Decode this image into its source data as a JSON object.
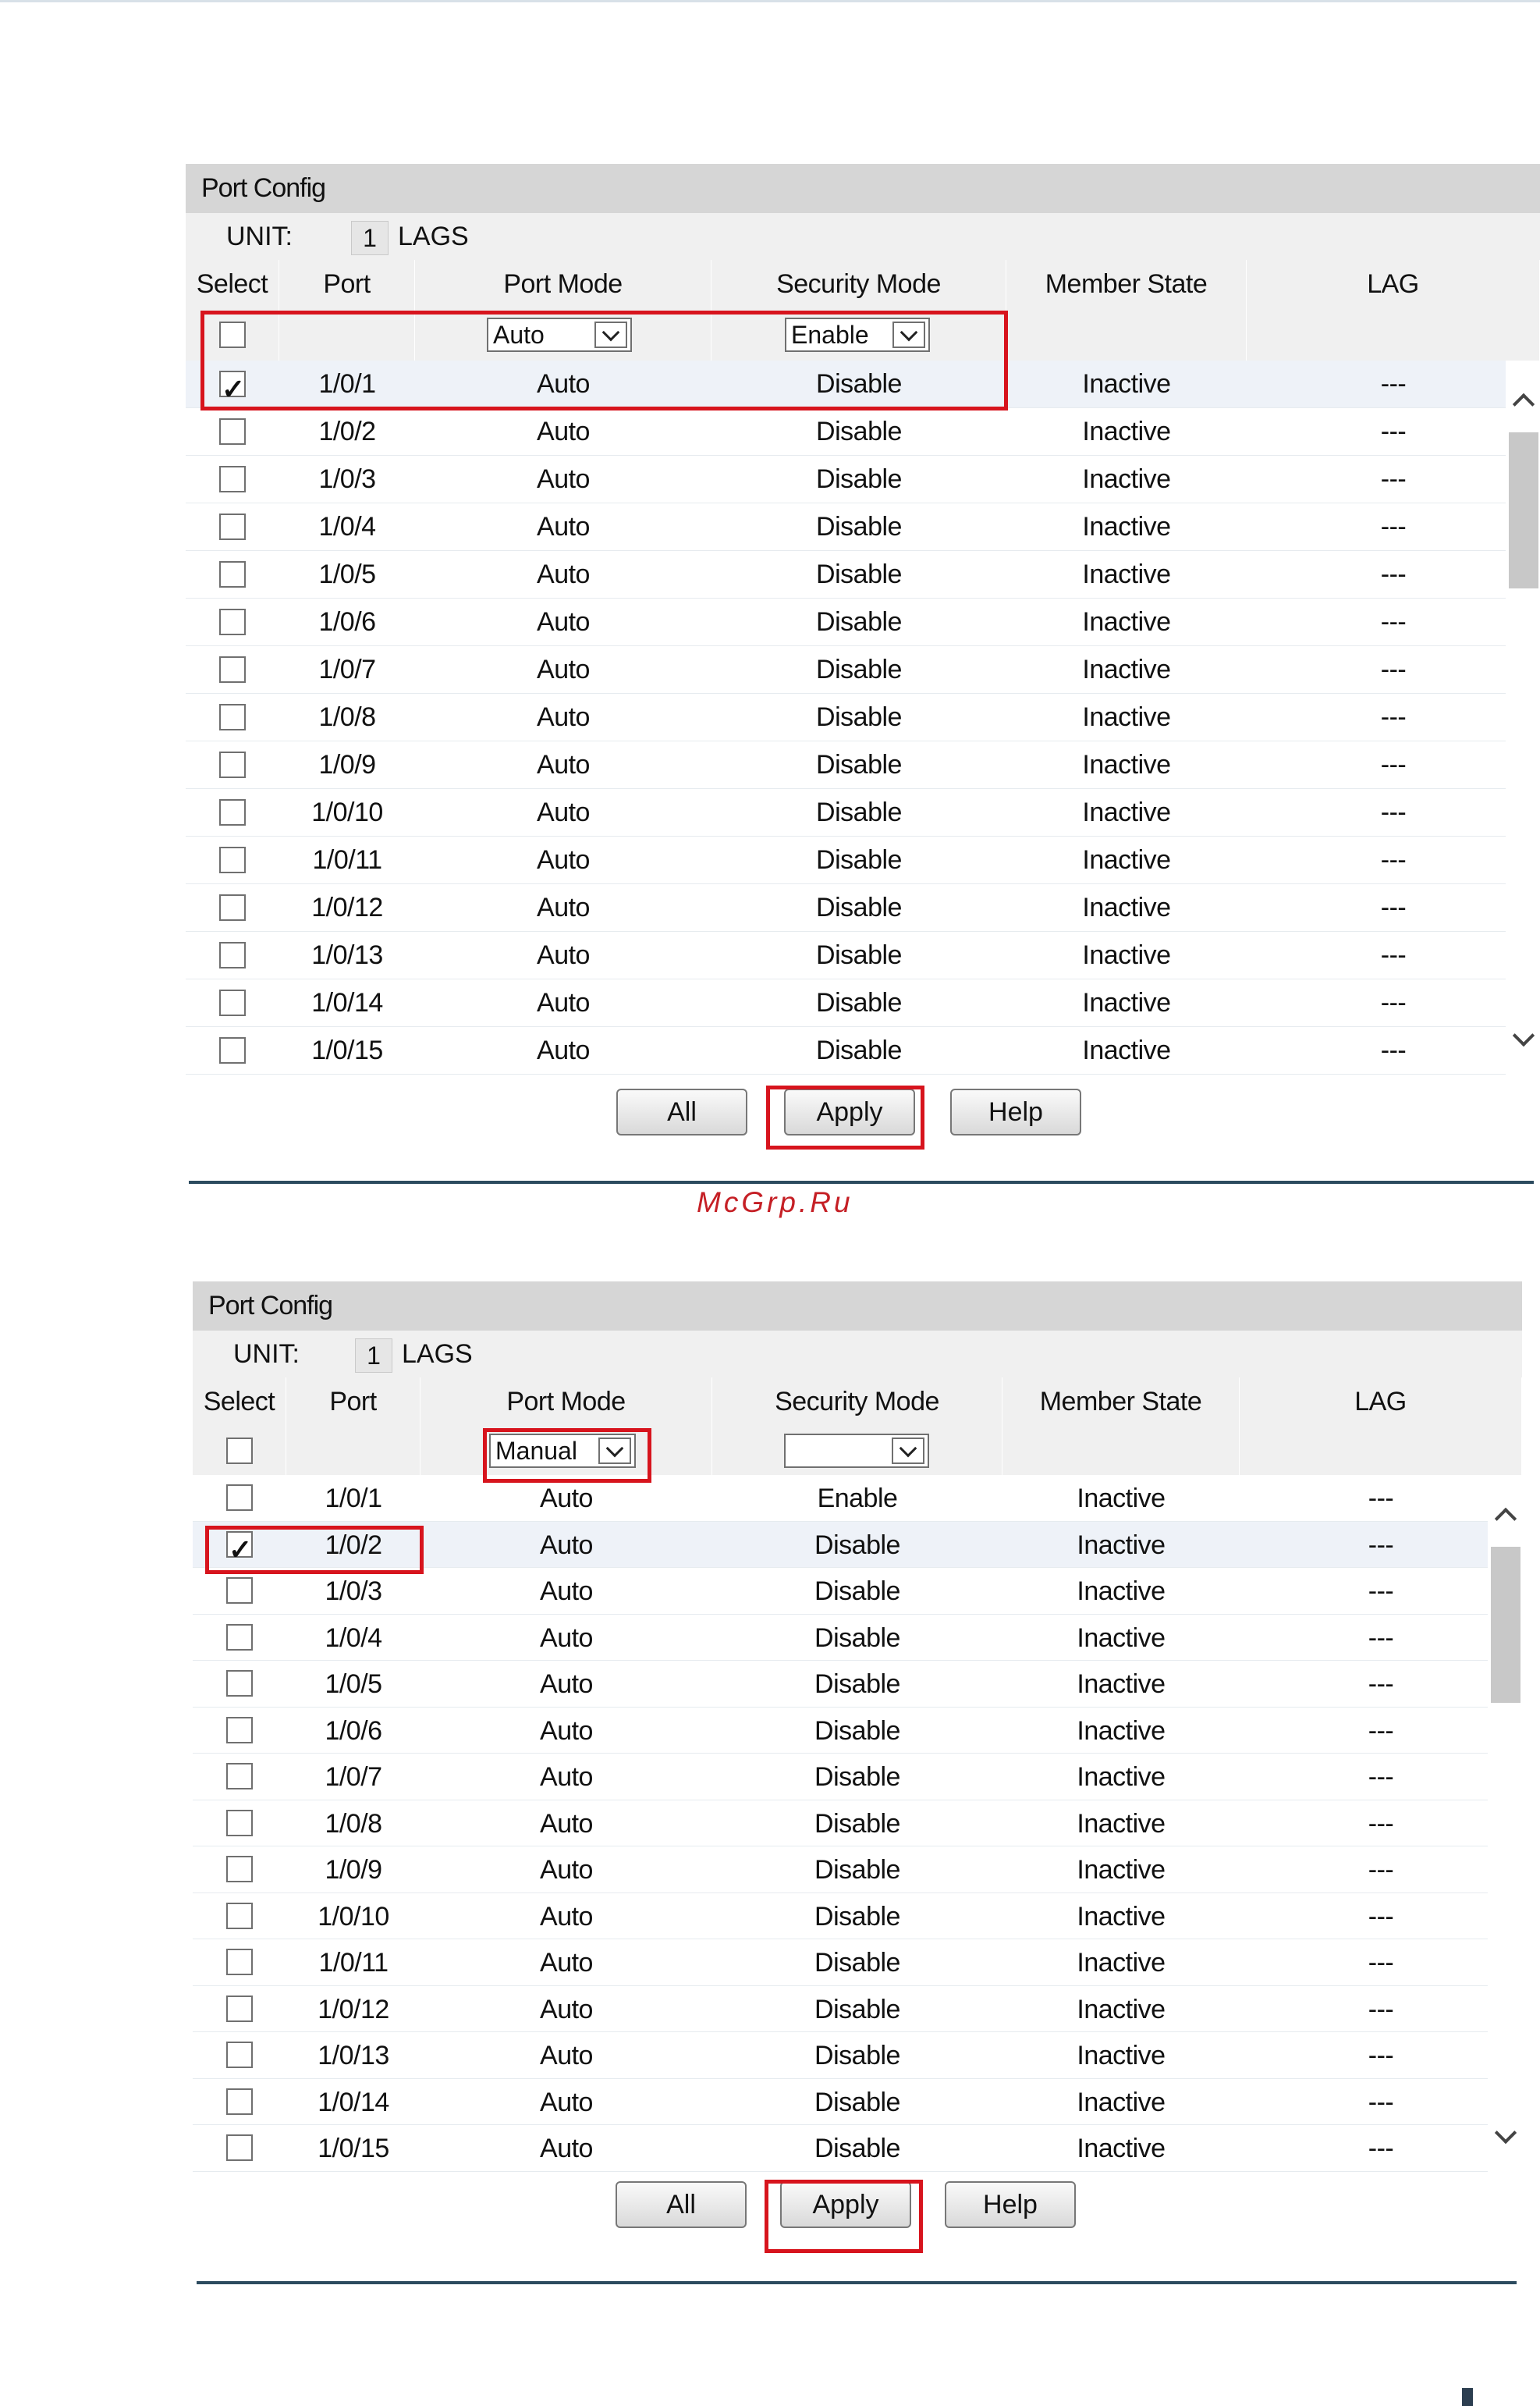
{
  "panels": [
    {
      "title": "Port Config",
      "unit_label": "UNIT:",
      "unit_value": "1",
      "lags_label": "LAGS",
      "columns": [
        "Select",
        "Port",
        "Port Mode",
        "Security Mode",
        "Member State",
        "LAG"
      ],
      "filter": {
        "select_all_checked": false,
        "port_mode": "Auto",
        "security_mode": "Enable"
      },
      "rows": [
        {
          "checked": true,
          "port": "1/0/1",
          "port_mode": "Auto",
          "security_mode": "Disable",
          "member_state": "Inactive",
          "lag": "---"
        },
        {
          "checked": false,
          "port": "1/0/2",
          "port_mode": "Auto",
          "security_mode": "Disable",
          "member_state": "Inactive",
          "lag": "---"
        },
        {
          "checked": false,
          "port": "1/0/3",
          "port_mode": "Auto",
          "security_mode": "Disable",
          "member_state": "Inactive",
          "lag": "---"
        },
        {
          "checked": false,
          "port": "1/0/4",
          "port_mode": "Auto",
          "security_mode": "Disable",
          "member_state": "Inactive",
          "lag": "---"
        },
        {
          "checked": false,
          "port": "1/0/5",
          "port_mode": "Auto",
          "security_mode": "Disable",
          "member_state": "Inactive",
          "lag": "---"
        },
        {
          "checked": false,
          "port": "1/0/6",
          "port_mode": "Auto",
          "security_mode": "Disable",
          "member_state": "Inactive",
          "lag": "---"
        },
        {
          "checked": false,
          "port": "1/0/7",
          "port_mode": "Auto",
          "security_mode": "Disable",
          "member_state": "Inactive",
          "lag": "---"
        },
        {
          "checked": false,
          "port": "1/0/8",
          "port_mode": "Auto",
          "security_mode": "Disable",
          "member_state": "Inactive",
          "lag": "---"
        },
        {
          "checked": false,
          "port": "1/0/9",
          "port_mode": "Auto",
          "security_mode": "Disable",
          "member_state": "Inactive",
          "lag": "---"
        },
        {
          "checked": false,
          "port": "1/0/10",
          "port_mode": "Auto",
          "security_mode": "Disable",
          "member_state": "Inactive",
          "lag": "---"
        },
        {
          "checked": false,
          "port": "1/0/11",
          "port_mode": "Auto",
          "security_mode": "Disable",
          "member_state": "Inactive",
          "lag": "---"
        },
        {
          "checked": false,
          "port": "1/0/12",
          "port_mode": "Auto",
          "security_mode": "Disable",
          "member_state": "Inactive",
          "lag": "---"
        },
        {
          "checked": false,
          "port": "1/0/13",
          "port_mode": "Auto",
          "security_mode": "Disable",
          "member_state": "Inactive",
          "lag": "---"
        },
        {
          "checked": false,
          "port": "1/0/14",
          "port_mode": "Auto",
          "security_mode": "Disable",
          "member_state": "Inactive",
          "lag": "---"
        },
        {
          "checked": false,
          "port": "1/0/15",
          "port_mode": "Auto",
          "security_mode": "Disable",
          "member_state": "Inactive",
          "lag": "---"
        }
      ],
      "buttons": {
        "all": "All",
        "apply": "Apply",
        "help": "Help"
      }
    },
    {
      "title": "Port Config",
      "unit_label": "UNIT:",
      "unit_value": "1",
      "lags_label": "LAGS",
      "columns": [
        "Select",
        "Port",
        "Port Mode",
        "Security Mode",
        "Member State",
        "LAG"
      ],
      "filter": {
        "select_all_checked": false,
        "port_mode": "Manual",
        "security_mode": ""
      },
      "rows": [
        {
          "checked": false,
          "port": "1/0/1",
          "port_mode": "Auto",
          "security_mode": "Enable",
          "member_state": "Inactive",
          "lag": "---"
        },
        {
          "checked": true,
          "port": "1/0/2",
          "port_mode": "Auto",
          "security_mode": "Disable",
          "member_state": "Inactive",
          "lag": "---"
        },
        {
          "checked": false,
          "port": "1/0/3",
          "port_mode": "Auto",
          "security_mode": "Disable",
          "member_state": "Inactive",
          "lag": "---"
        },
        {
          "checked": false,
          "port": "1/0/4",
          "port_mode": "Auto",
          "security_mode": "Disable",
          "member_state": "Inactive",
          "lag": "---"
        },
        {
          "checked": false,
          "port": "1/0/5",
          "port_mode": "Auto",
          "security_mode": "Disable",
          "member_state": "Inactive",
          "lag": "---"
        },
        {
          "checked": false,
          "port": "1/0/6",
          "port_mode": "Auto",
          "security_mode": "Disable",
          "member_state": "Inactive",
          "lag": "---"
        },
        {
          "checked": false,
          "port": "1/0/7",
          "port_mode": "Auto",
          "security_mode": "Disable",
          "member_state": "Inactive",
          "lag": "---"
        },
        {
          "checked": false,
          "port": "1/0/8",
          "port_mode": "Auto",
          "security_mode": "Disable",
          "member_state": "Inactive",
          "lag": "---"
        },
        {
          "checked": false,
          "port": "1/0/9",
          "port_mode": "Auto",
          "security_mode": "Disable",
          "member_state": "Inactive",
          "lag": "---"
        },
        {
          "checked": false,
          "port": "1/0/10",
          "port_mode": "Auto",
          "security_mode": "Disable",
          "member_state": "Inactive",
          "lag": "---"
        },
        {
          "checked": false,
          "port": "1/0/11",
          "port_mode": "Auto",
          "security_mode": "Disable",
          "member_state": "Inactive",
          "lag": "---"
        },
        {
          "checked": false,
          "port": "1/0/12",
          "port_mode": "Auto",
          "security_mode": "Disable",
          "member_state": "Inactive",
          "lag": "---"
        },
        {
          "checked": false,
          "port": "1/0/13",
          "port_mode": "Auto",
          "security_mode": "Disable",
          "member_state": "Inactive",
          "lag": "---"
        },
        {
          "checked": false,
          "port": "1/0/14",
          "port_mode": "Auto",
          "security_mode": "Disable",
          "member_state": "Inactive",
          "lag": "---"
        },
        {
          "checked": false,
          "port": "1/0/15",
          "port_mode": "Auto",
          "security_mode": "Disable",
          "member_state": "Inactive",
          "lag": "---"
        }
      ],
      "buttons": {
        "all": "All",
        "apply": "Apply",
        "help": "Help"
      }
    }
  ],
  "watermark": "McGrp.Ru",
  "colors": {
    "highlight": "#d7141d",
    "header_bg": "#d6d6d6",
    "row_bg": "#f0f0f0",
    "separator": "#2c4b5f"
  }
}
